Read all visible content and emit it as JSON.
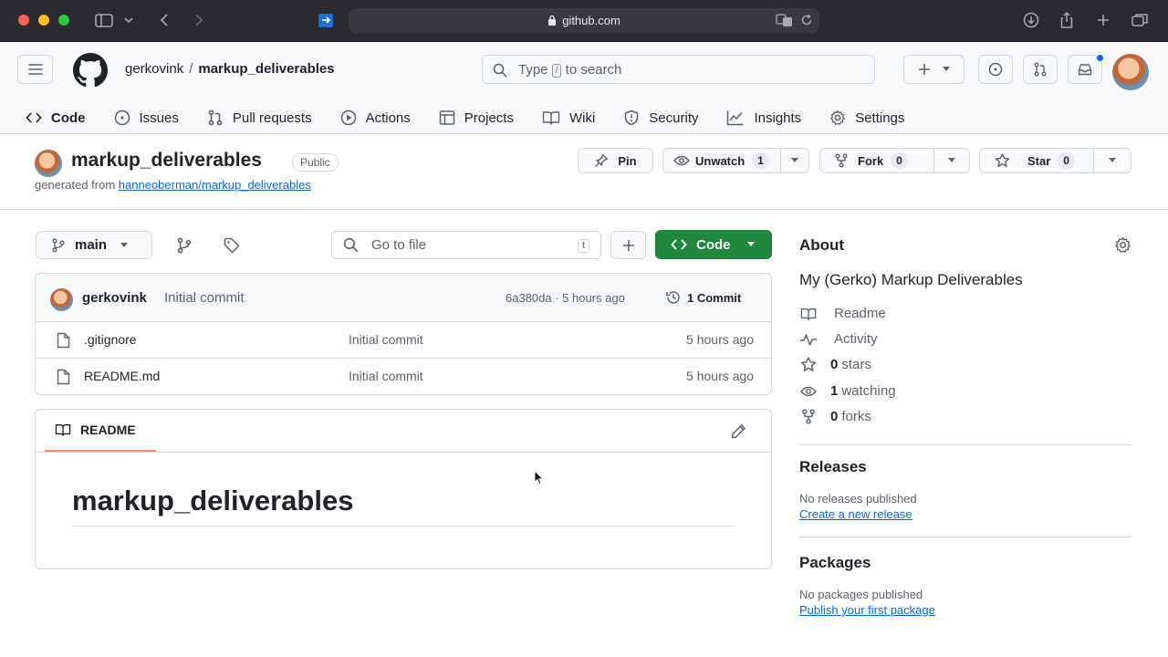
{
  "browser": {
    "url": "github.com"
  },
  "header": {
    "owner": "gerkovink",
    "separator": "/",
    "repo": "markup_deliverables",
    "search": {
      "prefix": "Type",
      "key": "/",
      "suffix": "to search"
    },
    "notification_color": "#0969da"
  },
  "tabs": [
    {
      "label": "Code",
      "icon": "code-icon",
      "active": true
    },
    {
      "label": "Issues",
      "icon": "issue-icon"
    },
    {
      "label": "Pull requests",
      "icon": "pull-request-icon"
    },
    {
      "label": "Actions",
      "icon": "play-icon"
    },
    {
      "label": "Projects",
      "icon": "table-icon"
    },
    {
      "label": "Wiki",
      "icon": "book-icon"
    },
    {
      "label": "Security",
      "icon": "shield-icon"
    },
    {
      "label": "Insights",
      "icon": "graph-icon"
    },
    {
      "label": "Settings",
      "icon": "gear-icon"
    }
  ],
  "repo": {
    "name": "markup_deliverables",
    "visibility": "Public",
    "generated_from_label": "generated from",
    "generated_from_link": "hanneoberman/markup_deliverables",
    "actions": {
      "pin": "Pin",
      "unwatch": "Unwatch",
      "watch_count": "1",
      "fork": "Fork",
      "fork_count": "0",
      "star": "Star",
      "star_count": "0"
    }
  },
  "toolbar": {
    "branch": "main",
    "goto_file": "Go to file",
    "goto_key": "t",
    "code_button": "Code",
    "accent": "#1f883d"
  },
  "commit": {
    "author": "gerkovink",
    "message": "Initial commit",
    "hash_time": "6a380da · 5 hours ago",
    "count": "1 Commit"
  },
  "files": [
    {
      "name": ".gitignore",
      "message": "Initial commit",
      "time": "5 hours ago"
    },
    {
      "name": "README.md",
      "message": "Initial commit",
      "time": "5 hours ago"
    }
  ],
  "readme": {
    "tab": "README",
    "heading": "markup_deliverables",
    "tab_underline_color": "#fd8c73"
  },
  "about": {
    "title": "About",
    "description": "My (Gerko) Markup Deliverables",
    "items": [
      {
        "icon": "book-icon",
        "bold": "",
        "text": "Readme"
      },
      {
        "icon": "pulse-icon",
        "bold": "",
        "text": "Activity"
      },
      {
        "icon": "star-icon",
        "bold": "0",
        "text": "stars"
      },
      {
        "icon": "eye-icon",
        "bold": "1",
        "text": "watching"
      },
      {
        "icon": "fork-icon",
        "bold": "0",
        "text": "forks"
      }
    ]
  },
  "releases": {
    "title": "Releases",
    "empty": "No releases published",
    "link": "Create a new release"
  },
  "packages": {
    "title": "Packages",
    "empty": "No packages published",
    "link": "Publish your first package"
  }
}
